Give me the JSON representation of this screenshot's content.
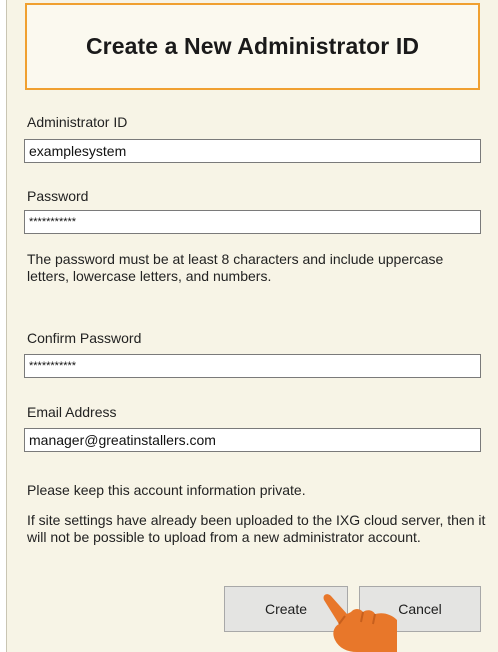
{
  "dialog": {
    "title": "Create a New Administrator ID",
    "admin_id": {
      "label": "Administrator ID",
      "value": "examplesystem"
    },
    "password": {
      "label": "Password",
      "value": "***********"
    },
    "password_hint": "The password must be at least 8 characters and include uppercase letters, lowercase letters, and numbers.",
    "confirm_password": {
      "label": "Confirm Password",
      "value": "***********"
    },
    "email": {
      "label": "Email Address",
      "value": "manager@greatinstallers.com"
    },
    "private_note": "Please keep this account information private.",
    "upload_note": "If site settings have already been uploaded to the IXG cloud server, then it will not be possible to upload from a new administrator account.",
    "buttons": {
      "create": "Create",
      "cancel": "Cancel"
    }
  },
  "colors": {
    "title_border": "#f0a030",
    "background": "#f7f4e6",
    "hand": "#e8772a"
  },
  "icons": {
    "pointer": "pointing-hand-icon"
  }
}
